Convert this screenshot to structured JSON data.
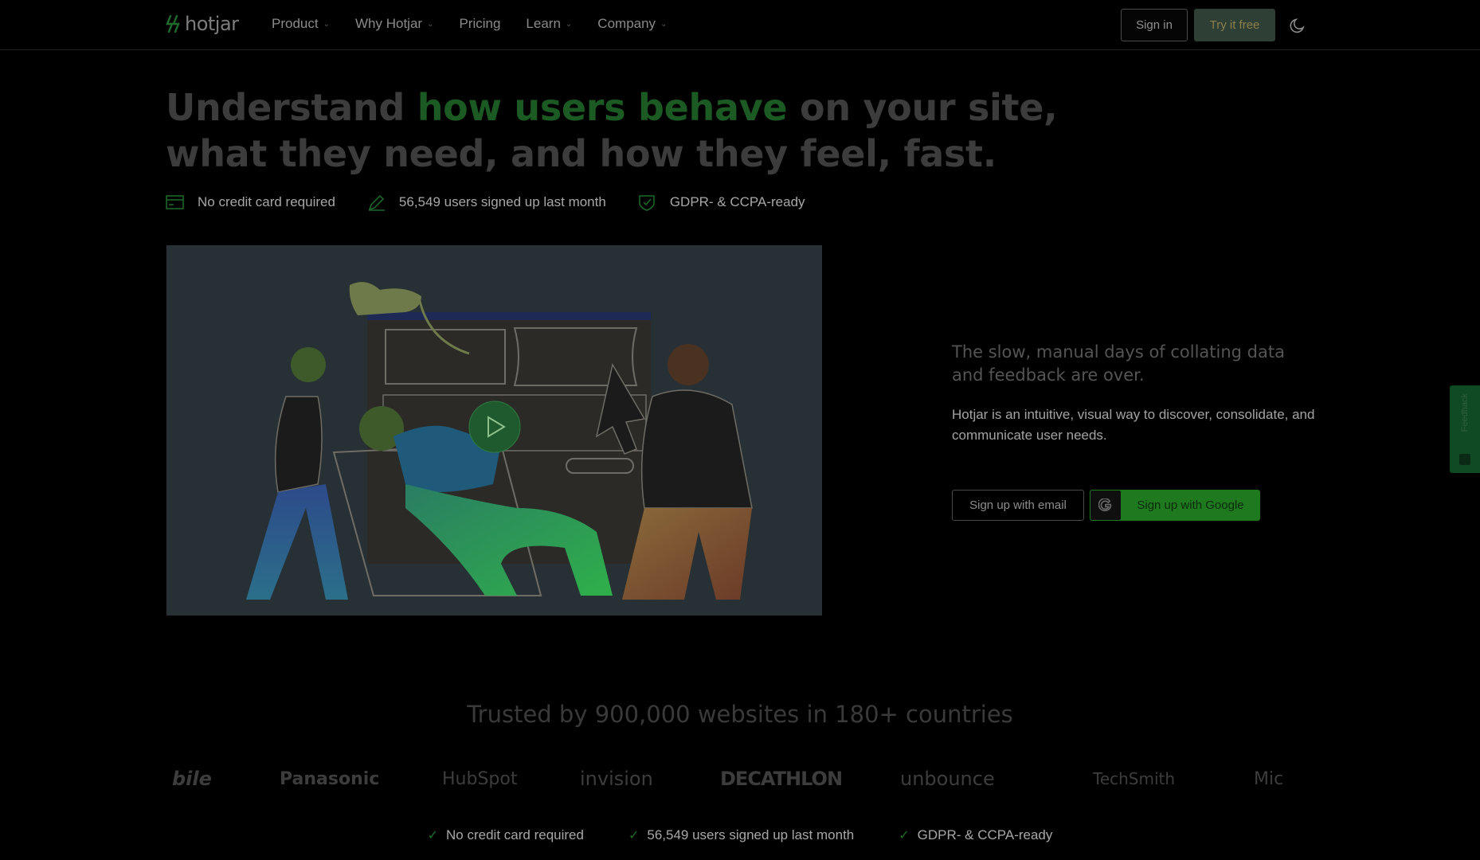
{
  "nav": {
    "logo_text": "hotjar",
    "items": [
      {
        "label": "Product",
        "has_dropdown": true
      },
      {
        "label": "Why Hotjar",
        "has_dropdown": true
      },
      {
        "label": "Pricing",
        "has_dropdown": false
      },
      {
        "label": "Learn",
        "has_dropdown": true
      },
      {
        "label": "Company",
        "has_dropdown": true
      }
    ],
    "sign_in": "Sign in",
    "try_free": "Try it free",
    "theme_icon": "moon-icon"
  },
  "hero": {
    "headline_pre": "Understand ",
    "headline_accent": "how users behave",
    "headline_post": " on your site, what they need, and how they feel, fast.",
    "badges": [
      {
        "icon": "credit-card-icon",
        "text": "No credit card required"
      },
      {
        "icon": "pencil-icon",
        "text": "56,549 users signed up last month"
      },
      {
        "icon": "shield-check-icon",
        "text": "GDPR- & CCPA-ready"
      }
    ]
  },
  "side": {
    "title": "The slow, manual days of collating data and feedback are over.",
    "text": "Hotjar is an intuitive, visual way to discover, consolidate, and communicate user needs.",
    "email_btn": "Sign up with email",
    "google_btn": "Sign up with Google"
  },
  "feedback_tab": "Feedback",
  "trusted": {
    "title": "Trusted by 900,000 websites in 180+ countries",
    "logos": [
      "bile",
      "Panasonic",
      "HubSpot",
      "invision",
      "DECATHLON",
      "unbounce",
      "TechSmith",
      "Mic"
    ]
  },
  "checks": [
    "No credit card required",
    "56,549 users signed up last month",
    "GDPR- & CCPA-ready"
  ],
  "colors": {
    "accent": "#1c5a23",
    "google_btn": "#1f7a1f",
    "try_btn": "#2e3f36",
    "background": "#000000"
  }
}
